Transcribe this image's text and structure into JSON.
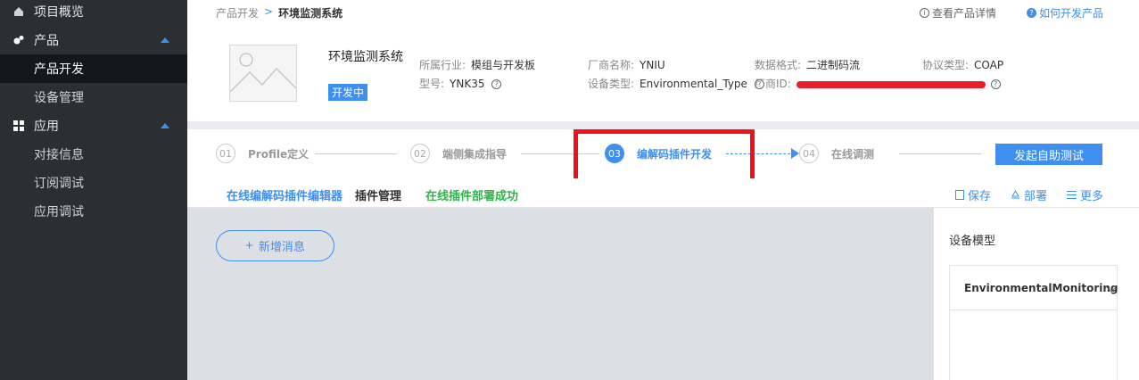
{
  "sidebar": {
    "items": [
      {
        "label": "项目概览",
        "icon": "home-icon"
      },
      {
        "label": "产品",
        "icon": "product-icon"
      },
      {
        "label": "产品开发"
      },
      {
        "label": "设备管理"
      },
      {
        "label": "应用",
        "icon": "app-grid-icon"
      },
      {
        "label": "对接信息"
      },
      {
        "label": "订阅调试"
      },
      {
        "label": "应用调试"
      }
    ]
  },
  "breadcrumb": {
    "parent": "产品开发",
    "sep": ">",
    "current": "环境监测系统"
  },
  "toplinks": {
    "details": "查看产品详情",
    "howto": "如何开发产品"
  },
  "product": {
    "name": "环境监测系统",
    "status": "开发中",
    "industry_label": "所属行业:",
    "industry": "模组与开发板",
    "model_label": "型号:",
    "model": "YNK35",
    "vendor_label": "厂商名称:",
    "vendor": "YNIU",
    "devtype_label": "设备类型:",
    "devtype": "Environmental_Type",
    "format_label": "数据格式:",
    "format": "二进制码流",
    "vendorid_label": "厂商ID:",
    "protocol_label": "协议类型:",
    "protocol": "COAP"
  },
  "steps": [
    {
      "num": "01",
      "label": "Profile定义"
    },
    {
      "num": "02",
      "label": "端侧集成指导"
    },
    {
      "num": "03",
      "label": "编解码插件开发"
    },
    {
      "num": "04",
      "label": "在线调测"
    }
  ],
  "self_test_button": "发起自助测试",
  "tabs": {
    "editor": "在线编解码插件编辑器",
    "manage": "插件管理",
    "deployed": "在线插件部署成功"
  },
  "actions": {
    "save": "保存",
    "deploy": "部署",
    "more": "更多"
  },
  "editor": {
    "add_message": "新增消息"
  },
  "model_panel": {
    "title": "设备模型",
    "selected": "EnvironmentalMonitoring"
  },
  "colors": {
    "accent": "#3f8ff0",
    "sidebar": "#2b2e33",
    "success": "#2fb44a",
    "highlight": "#f0101a"
  }
}
